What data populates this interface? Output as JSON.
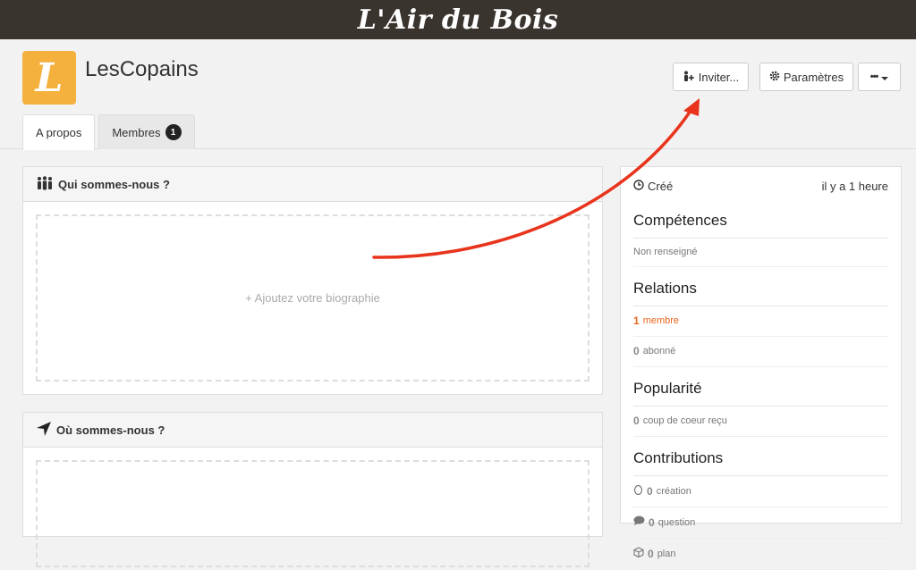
{
  "brand": "L'Air du Bois",
  "group": {
    "avatar_letter": "L",
    "name": "LesCopains"
  },
  "actions": {
    "invite": "Inviter...",
    "settings": "Paramètres",
    "more": "•••"
  },
  "tabs": [
    {
      "label": "A propos",
      "active": true
    },
    {
      "label": "Membres",
      "badge": "1"
    }
  ],
  "about": {
    "title": "Qui sommes-nous ?",
    "add_bio": "+ Ajoutez votre biographie"
  },
  "location": {
    "title": "Où sommes-nous ?"
  },
  "sidebar": {
    "created_label": "Créé",
    "created_value": "il y a 1 heure",
    "skills": {
      "title": "Compétences",
      "value": "Non renseigné"
    },
    "relations": {
      "title": "Relations",
      "members_count": "1",
      "members_label": "membre",
      "followers_count": "0",
      "followers_label": "abonné"
    },
    "popularity": {
      "title": "Popularité",
      "count": "0",
      "label": "coup de coeur reçu"
    },
    "contributions": {
      "title": "Contributions",
      "items": [
        {
          "icon": "egg-icon",
          "count": "0",
          "label": "création"
        },
        {
          "icon": "speech-bubble-icon",
          "count": "0",
          "label": "question"
        },
        {
          "icon": "box-icon",
          "count": "0",
          "label": "plan"
        }
      ]
    }
  },
  "colors": {
    "topbar": "#3a342e",
    "avatar": "#f5b13d",
    "accent": "#e8661e",
    "arrow": "#e8341c"
  }
}
